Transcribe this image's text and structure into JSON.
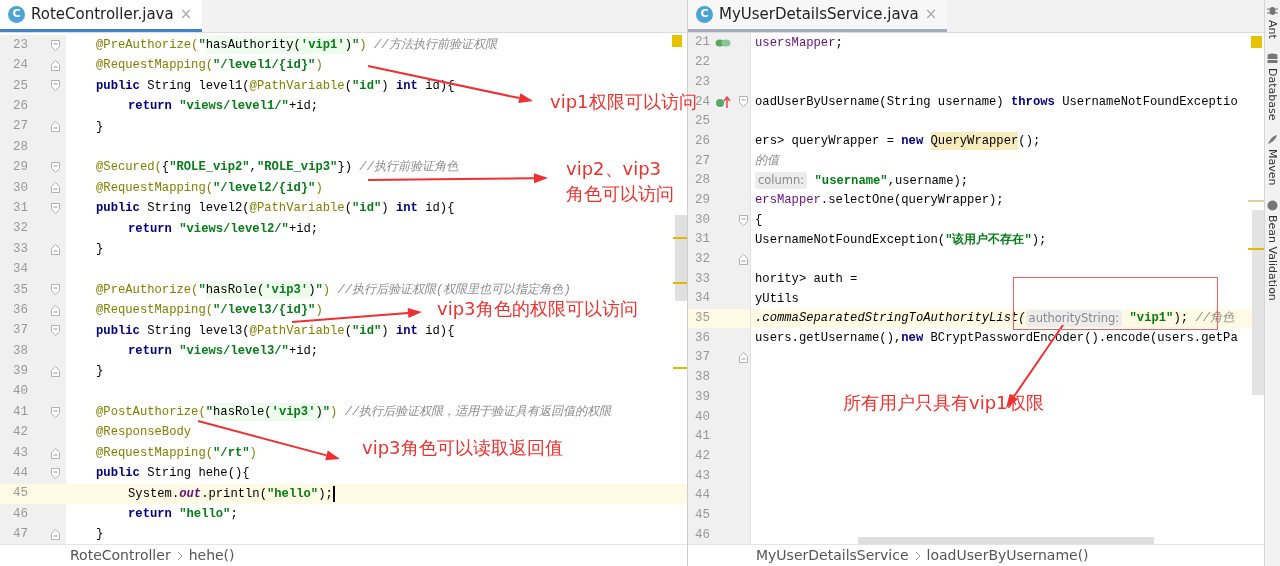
{
  "editors": [
    {
      "focused": true,
      "tab": {
        "icon_letter": "C",
        "label": "RoteController.java",
        "close": "×"
      },
      "lines": [
        {
          "number": "23",
          "current": false,
          "tokens": [
            {
              "kind": "annotation",
              "text": "@PreAuthorize("
            },
            {
              "kind": "string",
              "text": "\""
            },
            {
              "kind": "injected",
              "text": "hasAuthority("
            },
            {
              "kind": "injected_string",
              "text": "'vip1'"
            },
            {
              "kind": "injected",
              "text": ")"
            },
            {
              "kind": "string",
              "text": "\""
            },
            {
              "kind": "annotation",
              "text": ") "
            },
            {
              "kind": "comment",
              "text": "//方法执行前验证权限"
            }
          ]
        },
        {
          "number": "24",
          "current": false,
          "tokens": [
            {
              "kind": "annotation",
              "text": "@RequestMapping("
            },
            {
              "kind": "string",
              "text": "\"/level1/{id}\""
            },
            {
              "kind": "annotation",
              "text": ")"
            }
          ]
        },
        {
          "number": "25",
          "current": false,
          "tokens": [
            {
              "kind": "keyword",
              "text": "public"
            },
            {
              "kind": "plain",
              "text": " String level1("
            },
            {
              "kind": "annotation",
              "text": "@PathVariable"
            },
            {
              "kind": "plain",
              "text": "("
            },
            {
              "kind": "string",
              "text": "\"id\""
            },
            {
              "kind": "plain",
              "text": ") "
            },
            {
              "kind": "keyword",
              "text": "int"
            },
            {
              "kind": "plain",
              "text": " id){"
            }
          ]
        },
        {
          "number": "26",
          "current": false,
          "tokens": [
            {
              "kind": "keyword",
              "text": "return "
            },
            {
              "kind": "string",
              "text": "\"views/level1/\""
            },
            {
              "kind": "plain",
              "text": "+id;"
            }
          ]
        },
        {
          "number": "27",
          "current": false,
          "tokens": [
            {
              "kind": "plain",
              "text": "}"
            }
          ]
        },
        {
          "number": "28",
          "current": false
        },
        {
          "number": "29",
          "current": false,
          "tokens": [
            {
              "kind": "annotation",
              "text": "@Secured("
            },
            {
              "kind": "plain",
              "text": "{"
            },
            {
              "kind": "string",
              "text": "\"ROLE_vip2\""
            },
            {
              "kind": "plain",
              "text": ","
            },
            {
              "kind": "string",
              "text": "\"ROLE_vip3\""
            },
            {
              "kind": "plain",
              "text": "}) "
            },
            {
              "kind": "comment",
              "text": "//执行前验证角色"
            }
          ]
        },
        {
          "number": "30",
          "current": false,
          "tokens": [
            {
              "kind": "annotation",
              "text": "@RequestMapping("
            },
            {
              "kind": "string",
              "text": "\"/level2/{id}\""
            },
            {
              "kind": "annotation",
              "text": ")"
            }
          ]
        },
        {
          "number": "31",
          "current": false,
          "tokens": [
            {
              "kind": "keyword",
              "text": "public"
            },
            {
              "kind": "plain",
              "text": " String level2("
            },
            {
              "kind": "annotation",
              "text": "@PathVariable"
            },
            {
              "kind": "plain",
              "text": "("
            },
            {
              "kind": "string",
              "text": "\"id\""
            },
            {
              "kind": "plain",
              "text": ") "
            },
            {
              "kind": "keyword",
              "text": "int"
            },
            {
              "kind": "plain",
              "text": " id){"
            }
          ]
        },
        {
          "number": "32",
          "current": false,
          "tokens": [
            {
              "kind": "keyword",
              "text": "return "
            },
            {
              "kind": "string",
              "text": "\"views/level2/\""
            },
            {
              "kind": "plain",
              "text": "+id;"
            }
          ]
        },
        {
          "number": "33",
          "current": false,
          "tokens": [
            {
              "kind": "plain",
              "text": "}"
            }
          ]
        },
        {
          "number": "34",
          "current": false
        },
        {
          "number": "35",
          "current": false,
          "tokens": [
            {
              "kind": "annotation",
              "text": "@PreAuthorize("
            },
            {
              "kind": "string",
              "text": "\""
            },
            {
              "kind": "injected",
              "text": "hasRole("
            },
            {
              "kind": "injected_string",
              "text": "'vip3'"
            },
            {
              "kind": "injected",
              "text": ")"
            },
            {
              "kind": "string",
              "text": "\""
            },
            {
              "kind": "annotation",
              "text": ") "
            },
            {
              "kind": "comment",
              "text": "//执行后验证权限(权限里也可以指定角色)"
            }
          ]
        },
        {
          "number": "36",
          "current": false,
          "tokens": [
            {
              "kind": "annotation",
              "text": "@RequestMapping("
            },
            {
              "kind": "string",
              "text": "\"/level3/{id}\""
            },
            {
              "kind": "annotation",
              "text": ")"
            }
          ]
        },
        {
          "number": "37",
          "current": false,
          "tokens": [
            {
              "kind": "keyword",
              "text": "public"
            },
            {
              "kind": "plain",
              "text": " String level3("
            },
            {
              "kind": "annotation",
              "text": "@PathVariable"
            },
            {
              "kind": "plain",
              "text": "("
            },
            {
              "kind": "string",
              "text": "\"id\""
            },
            {
              "kind": "plain",
              "text": ") "
            },
            {
              "kind": "keyword",
              "text": "int"
            },
            {
              "kind": "plain",
              "text": " id){"
            }
          ]
        },
        {
          "number": "38",
          "current": false,
          "tokens": [
            {
              "kind": "keyword",
              "text": "return "
            },
            {
              "kind": "string",
              "text": "\"views/level3/\""
            },
            {
              "kind": "plain",
              "text": "+id;"
            }
          ]
        },
        {
          "number": "39",
          "current": false,
          "tokens": [
            {
              "kind": "plain",
              "text": "}"
            }
          ]
        },
        {
          "number": "40",
          "current": false
        },
        {
          "number": "41",
          "current": false,
          "tokens": [
            {
              "kind": "annotation",
              "text": "@PostAuthorize("
            },
            {
              "kind": "string",
              "text": "\""
            },
            {
              "kind": "injected",
              "text": "hasRole("
            },
            {
              "kind": "injected_string",
              "text": "'vip3'"
            },
            {
              "kind": "injected",
              "text": ")"
            },
            {
              "kind": "string",
              "text": "\""
            },
            {
              "kind": "annotation",
              "text": ") "
            },
            {
              "kind": "comment",
              "text": "//执行后验证权限，适用于验证具有返回值的权限"
            }
          ]
        },
        {
          "number": "42",
          "current": false,
          "tokens": [
            {
              "kind": "annotation",
              "text": "@ResponseBody"
            }
          ]
        },
        {
          "number": "43",
          "current": false,
          "tokens": [
            {
              "kind": "annotation",
              "text": "@RequestMapping("
            },
            {
              "kind": "string",
              "text": "\"/rt\""
            },
            {
              "kind": "annotation",
              "text": ")"
            }
          ]
        },
        {
          "number": "44",
          "current": false,
          "tokens": [
            {
              "kind": "keyword",
              "text": "public"
            },
            {
              "kind": "plain",
              "text": " String hehe(){"
            }
          ]
        },
        {
          "number": "45",
          "current": true,
          "caret": true,
          "tokens": [
            {
              "kind": "plain",
              "text": "System."
            },
            {
              "kind": "static_field",
              "text": "out"
            },
            {
              "kind": "plain",
              "text": ".println("
            },
            {
              "kind": "string",
              "text": "\"hello\""
            },
            {
              "kind": "plain",
              "text": ");"
            }
          ]
        },
        {
          "number": "46",
          "current": false,
          "tokens": [
            {
              "kind": "keyword",
              "text": "return "
            },
            {
              "kind": "string",
              "text": "\"hello\""
            },
            {
              "kind": "plain",
              "text": ";"
            }
          ]
        },
        {
          "number": "47",
          "current": false,
          "tokens": [
            {
              "kind": "plain",
              "text": "}"
            }
          ]
        }
      ],
      "breadcrumb": [
        "RoteController",
        "hehe()"
      ]
    },
    {
      "focused": false,
      "tab": {
        "icon_letter": "C",
        "label": "MyUserDetailsService.java",
        "close": "×"
      },
      "lines": [
        {
          "number": "21",
          "current": false,
          "tokens": [
            {
              "kind": "field",
              "text": "usersMapper"
            },
            {
              "kind": "plain",
              "text": ";"
            }
          ]
        },
        {
          "number": "22",
          "current": false
        },
        {
          "number": "23",
          "current": false
        },
        {
          "number": "24",
          "current": false,
          "tokens": [
            {
              "kind": "plain",
              "text": "oadUserByUsername(String username) "
            },
            {
              "kind": "keyword",
              "text": "throws"
            },
            {
              "kind": "plain",
              "text": " UsernameNotFoundExceptio"
            }
          ]
        },
        {
          "number": "25",
          "current": false
        },
        {
          "number": "26",
          "current": false,
          "tokens": [
            {
              "kind": "plain",
              "text": "ers> queryWrapper = "
            },
            {
              "kind": "keyword",
              "text": "new "
            },
            {
              "kind": "highlight",
              "text": "QueryWrapper"
            },
            {
              "kind": "plain",
              "text": "();"
            }
          ]
        },
        {
          "number": "27",
          "current": false,
          "tokens": [
            {
              "kind": "comment",
              "text": "的值"
            }
          ]
        },
        {
          "number": "28",
          "current": false,
          "tokens": [
            {
              "kind": "hint",
              "text": "column:"
            },
            {
              "kind": "string",
              "text": " \"username\""
            },
            {
              "kind": "plain",
              "text": ",username);"
            }
          ]
        },
        {
          "number": "29",
          "current": false,
          "tokens": [
            {
              "kind": "field",
              "text": "ersMapper"
            },
            {
              "kind": "plain",
              "text": ".selectOne(queryWrapper);"
            }
          ]
        },
        {
          "number": "30",
          "current": false,
          "tokens": [
            {
              "kind": "plain",
              "text": "{"
            }
          ]
        },
        {
          "number": "31",
          "current": false,
          "tokens": [
            {
              "kind": "plain",
              "text": "UsernameNotFoundException("
            },
            {
              "kind": "string",
              "text": "\"该用户不存在\""
            },
            {
              "kind": "plain",
              "text": ");"
            }
          ]
        },
        {
          "number": "32",
          "current": false
        },
        {
          "number": "33",
          "current": false,
          "tokens": [
            {
              "kind": "plain",
              "text": "hority> auth ="
            }
          ]
        },
        {
          "number": "34",
          "current": false,
          "tokens": [
            {
              "kind": "plain",
              "text": "yUtils"
            }
          ]
        },
        {
          "number": "35",
          "current": true,
          "tokens": [
            {
              "kind": "italic",
              "text": ".commaSeparatedStringToAuthorityList("
            },
            {
              "kind": "hint",
              "text": "authorityString:"
            },
            {
              "kind": "string",
              "text": " \"vip1\""
            },
            {
              "kind": "plain",
              "text": "); "
            },
            {
              "kind": "comment",
              "text": "//角色"
            }
          ]
        },
        {
          "number": "36",
          "current": false,
          "tokens": [
            {
              "kind": "plain",
              "text": "users.getUsername(),"
            },
            {
              "kind": "keyword",
              "text": "new"
            },
            {
              "kind": "plain",
              "text": " BCryptPasswordEncoder().encode(users.getPa"
            }
          ]
        },
        {
          "number": "37",
          "current": false
        },
        {
          "number": "38",
          "current": false
        },
        {
          "number": "39",
          "current": false
        },
        {
          "number": "40",
          "current": false
        },
        {
          "number": "41",
          "current": false
        },
        {
          "number": "42",
          "current": false
        },
        {
          "number": "43",
          "current": false
        },
        {
          "number": "44",
          "current": false
        },
        {
          "number": "45",
          "current": false
        },
        {
          "number": "46",
          "current": false
        }
      ],
      "breadcrumb": [
        "MyUserDetailsService",
        "loadUserByUsername()"
      ]
    }
  ],
  "tool_windows": [
    {
      "label": "Ant"
    },
    {
      "label": "Database"
    },
    {
      "label": "Maven"
    },
    {
      "label": "Bean Validation"
    }
  ],
  "callouts": [
    {
      "text": "vip1权限可以访问"
    },
    {
      "text": "vip2、vip3"
    },
    {
      "text": "角色可以访问"
    },
    {
      "text": "vip3角色的权限可以访问"
    },
    {
      "text": "vip3角色可以读取返回值"
    },
    {
      "text": "所有用户只具有vip1权限"
    }
  ]
}
